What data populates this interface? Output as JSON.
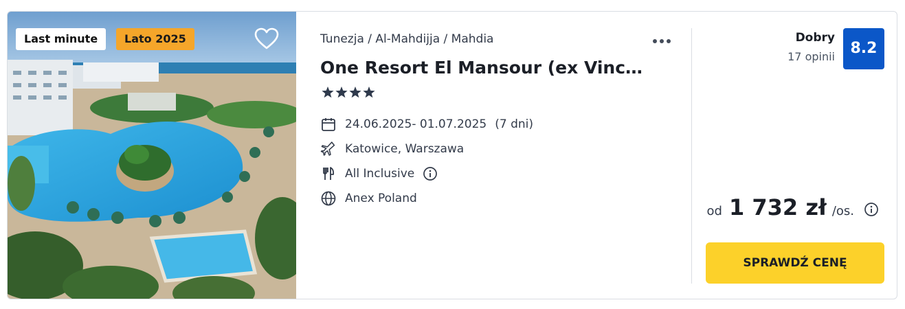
{
  "photo": {
    "badges": {
      "last_minute": "Last minute",
      "season": "Lato 2025"
    },
    "season_badge_color": "#f5a62a",
    "favorite_icon": "heart-outline-icon"
  },
  "hotel": {
    "breadcrumb": "Tunezja / Al-Mahdijja / Mahdia",
    "name": "One Resort El Mansour (ex Vinc…",
    "stars": 4,
    "dates": "24.06.2025- 01.07.2025",
    "duration": "(7 dni)",
    "departure": "Katowice, Warszawa",
    "board": "All Inclusive",
    "operator": "Anex Poland",
    "icons": {
      "dates": "calendar-icon",
      "departure": "airplane-icon",
      "board": "cutlery-icon",
      "operator": "globe-icon",
      "more": "more-dots-icon",
      "info": "info-icon"
    }
  },
  "rating": {
    "label": "Dobry",
    "count": "17 opinii",
    "score": "8.2",
    "score_color": "#0b57c8"
  },
  "price": {
    "prefix": "od",
    "amount": "1 732 zł",
    "unit": "/os."
  },
  "cta": {
    "label": "SPRAWDŹ CENĘ",
    "color": "#fcd12a"
  }
}
